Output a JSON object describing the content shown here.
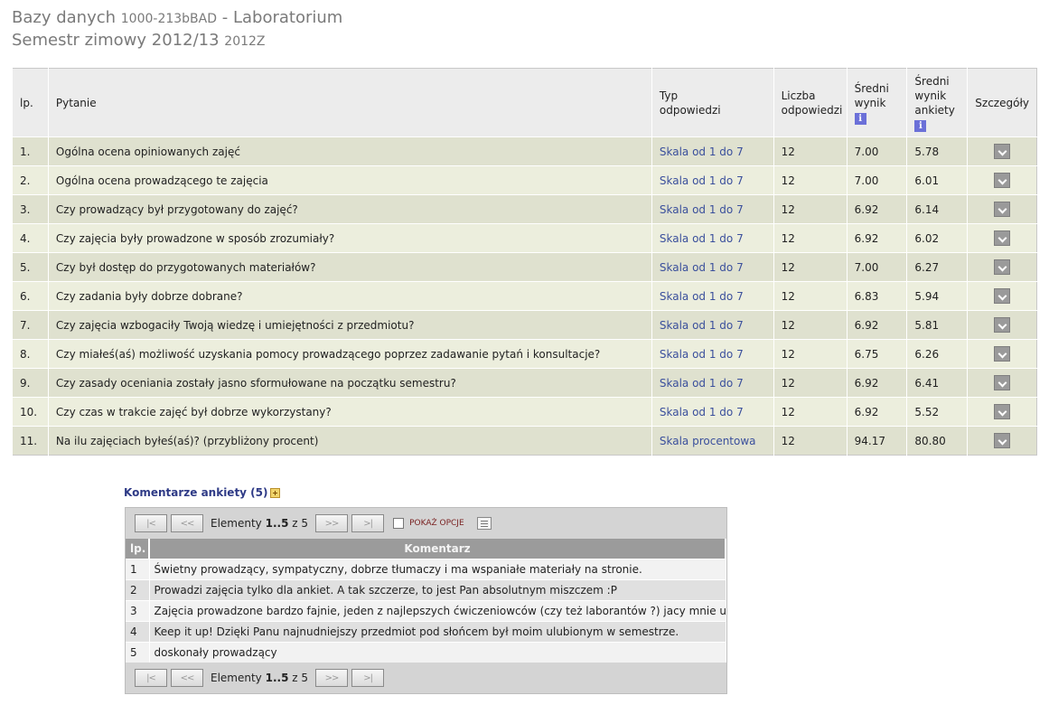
{
  "header": {
    "course_name": "Bazy danych",
    "course_code": "1000-213bBAD",
    "separator": "-",
    "class_type": "Laboratorium",
    "semester_name": "Semestr zimowy 2012/13",
    "semester_code": "2012Z"
  },
  "survey_table": {
    "columns": {
      "lp": "lp.",
      "question": "Pytanie",
      "answer_type": "Typ odpowiedzi",
      "answer_count": "Liczba odpowiedzi",
      "avg_score": "Średni wynik",
      "avg_survey_score": "Średni wynik ankiety",
      "details": "Szczegóły"
    },
    "info_icon": "info-icon",
    "rows": [
      {
        "lp": "1.",
        "question": "Ogólna ocena opiniowanych zajęć",
        "type": "Skala od 1 do 7",
        "count": "12",
        "avg": "7.00",
        "avg_survey": "5.78"
      },
      {
        "lp": "2.",
        "question": "Ogólna ocena prowadzącego te zajęcia",
        "type": "Skala od 1 do 7",
        "count": "12",
        "avg": "7.00",
        "avg_survey": "6.01"
      },
      {
        "lp": "3.",
        "question": "Czy prowadzący był przygotowany do zajęć?",
        "type": "Skala od 1 do 7",
        "count": "12",
        "avg": "6.92",
        "avg_survey": "6.14"
      },
      {
        "lp": "4.",
        "question": "Czy zajęcia były prowadzone w sposób zrozumiały?",
        "type": "Skala od 1 do 7",
        "count": "12",
        "avg": "6.92",
        "avg_survey": "6.02"
      },
      {
        "lp": "5.",
        "question": "Czy był dostęp do przygotowanych materiałów?",
        "type": "Skala od 1 do 7",
        "count": "12",
        "avg": "7.00",
        "avg_survey": "6.27"
      },
      {
        "lp": "6.",
        "question": "Czy zadania były dobrze dobrane?",
        "type": "Skala od 1 do 7",
        "count": "12",
        "avg": "6.83",
        "avg_survey": "5.94"
      },
      {
        "lp": "7.",
        "question": "Czy zajęcia wzbogaciły Twoją wiedzę i umiejętności z przedmiotu?",
        "type": "Skala od 1 do 7",
        "count": "12",
        "avg": "6.92",
        "avg_survey": "5.81"
      },
      {
        "lp": "8.",
        "question": "Czy miałeś(aś) możliwość uzyskania pomocy prowadzącego poprzez zadawanie pytań i konsultacje?",
        "type": "Skala od 1 do 7",
        "count": "12",
        "avg": "6.75",
        "avg_survey": "6.26"
      },
      {
        "lp": "9.",
        "question": "Czy zasady oceniania zostały jasno sformułowane na początku semestru?",
        "type": "Skala od 1 do 7",
        "count": "12",
        "avg": "6.92",
        "avg_survey": "6.41"
      },
      {
        "lp": "10.",
        "question": "Czy czas w trakcie zajęć był dobrze wykorzystany?",
        "type": "Skala od 1 do 7",
        "count": "12",
        "avg": "6.92",
        "avg_survey": "5.52"
      },
      {
        "lp": "11.",
        "question": "Na ilu zajęciach byłeś(aś)? (przybliżony procent)",
        "type": "Skala procentowa",
        "count": "12",
        "avg": "94.17",
        "avg_survey": "80.80"
      }
    ]
  },
  "comments": {
    "header": "Komentarze ankiety (5)",
    "pager": {
      "first": "|<",
      "prev": "<<",
      "next": ">>",
      "last": ">|",
      "elements_label": "Elementy",
      "range": "1..5",
      "of_label": "z",
      "total": "5",
      "show_options": "POKAŻ OPCJE"
    },
    "columns": {
      "lp": "lp.",
      "comment": "Komentarz"
    },
    "rows": [
      {
        "lp": "1",
        "text": "Świetny prowadzący, sympatyczny, dobrze tłumaczy i ma wspaniałe materiały na stronie."
      },
      {
        "lp": "2",
        "text": "Prowadzi zajęcia tylko dla ankiet. A tak szczerze, to jest Pan absolutnym miszczem :P"
      },
      {
        "lp": "3",
        "text": "Zajęcia prowadzone bardzo fajnie, jeden z najlepszych ćwiczeniowców (czy też laborantów ?) jacy mnie uczyli"
      },
      {
        "lp": "4",
        "text": "Keep it up! Dzięki Panu najnudniejszy przedmiot pod słońcem był moim ulubionym w semestrze."
      },
      {
        "lp": "5",
        "text": "doskonały prowadzący"
      }
    ]
  },
  "colors": {
    "row_odd": "#dfe1cf",
    "row_even": "#eceedd",
    "link": "#3a4f9c",
    "comments_header": "#2e3a86"
  }
}
